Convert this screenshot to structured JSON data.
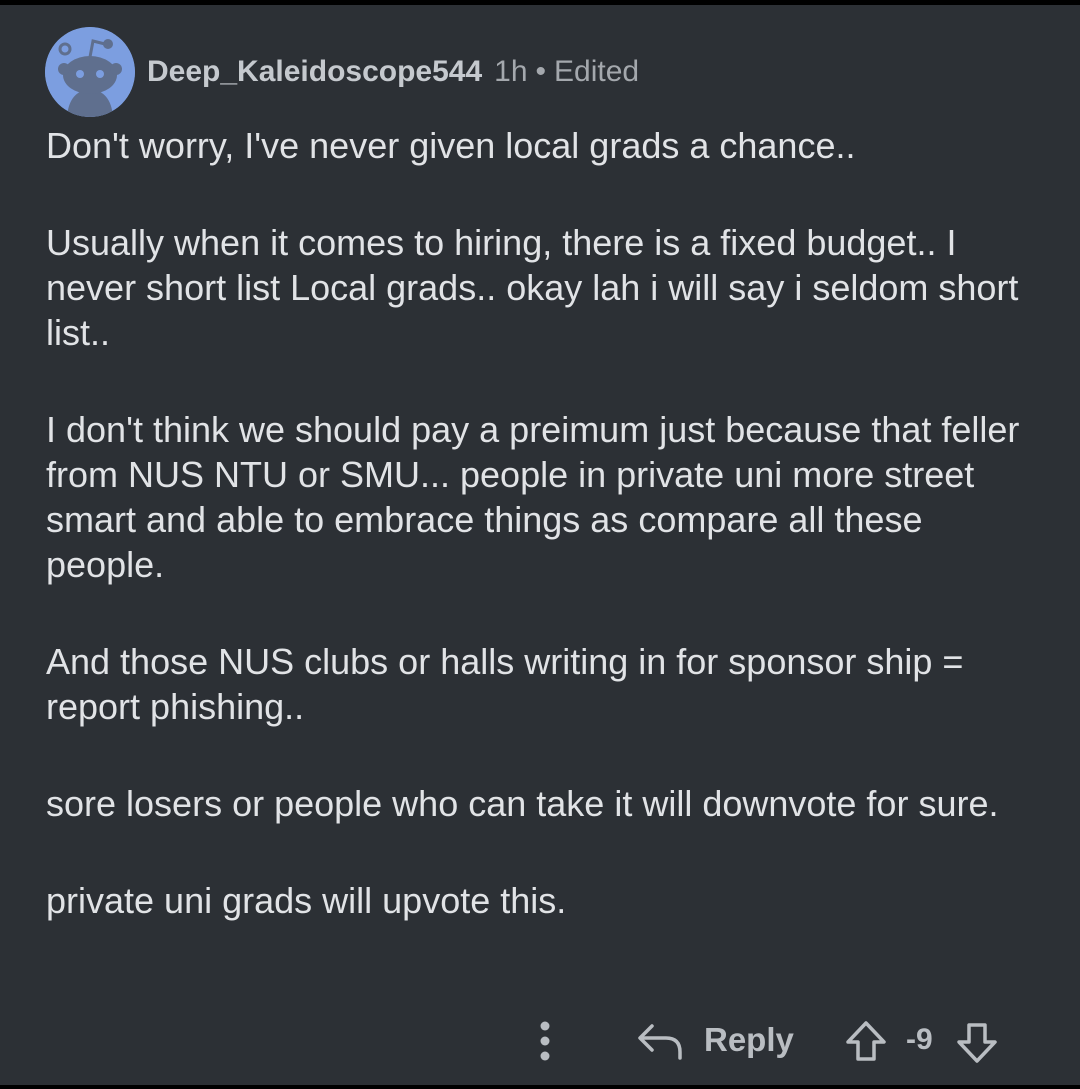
{
  "comment": {
    "author": "Deep_Kaleidoscope544",
    "time": "1h",
    "separator": "•",
    "edited": "Edited",
    "avatar_icon": "reddit-snoo-avatar",
    "paragraphs": [
      "Don't worry, I've never given local grads a chance..",
      "Usually when it comes to hiring, there is a fixed budget.. I never short list Local grads.. okay lah i will say i seldom short list..",
      "I don't think we should pay a preimum just because that feller from NUS NTU or SMU... people in private uni more street smart and able to embrace things as compare all these people.",
      "And those NUS clubs or halls writing in for sponsor ship = report phishing..",
      "sore losers or people who can take it will downvote for sure.",
      "private uni grads will upvote this."
    ]
  },
  "actions": {
    "more_icon": "more-vertical-icon",
    "reply_icon": "reply-arrow-icon",
    "reply_label": "Reply",
    "upvote_icon": "upvote-arrow-icon",
    "score": "-9",
    "downvote_icon": "downvote-arrow-icon"
  },
  "colors": {
    "background": "#2c3035",
    "avatar": "#7c9ee0",
    "text": "#e1e3e6",
    "muted": "#a4a8ad"
  }
}
